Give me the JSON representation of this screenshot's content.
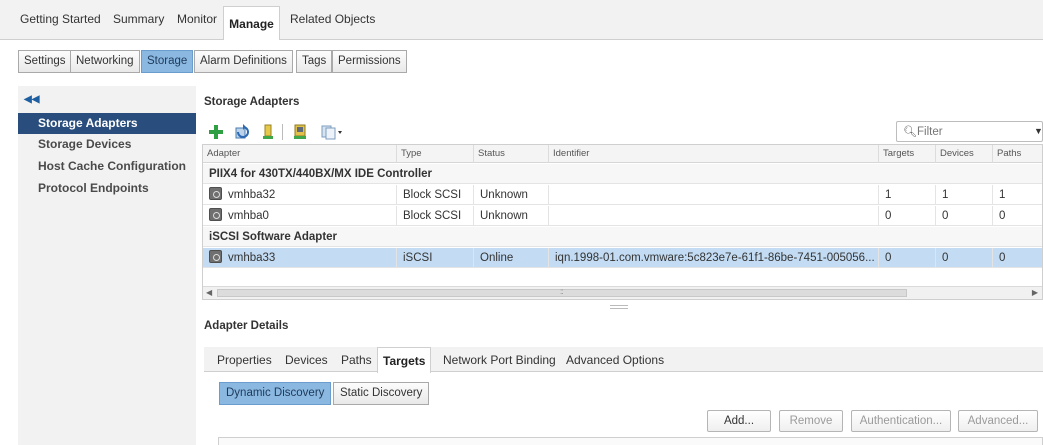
{
  "top_tabs": [
    "Getting Started",
    "Summary",
    "Monitor",
    "Manage",
    "Related Objects"
  ],
  "sub_tabs": [
    "Settings",
    "Networking",
    "Storage",
    "Alarm Definitions",
    "Tags",
    "Permissions"
  ],
  "leftnav": {
    "items": [
      "Storage Adapters",
      "Storage Devices",
      "Host Cache Configuration",
      "Protocol Endpoints"
    ]
  },
  "main": {
    "title": "Storage Adapters",
    "filter_placeholder": "Filter"
  },
  "grid": {
    "columns": [
      "Adapter",
      "Type",
      "Status",
      "Identifier",
      "Targets",
      "Devices",
      "Paths"
    ],
    "group1": "PIIX4 for 430TX/440BX/MX IDE Controller",
    "group2": "iSCSI Software Adapter",
    "rows": [
      {
        "adapter": "vmhba32",
        "type": "Block SCSI",
        "status": "Unknown",
        "identifier": "",
        "targets": "1",
        "devices": "1",
        "paths": "1"
      },
      {
        "adapter": "vmhba0",
        "type": "Block SCSI",
        "status": "Unknown",
        "identifier": "",
        "targets": "0",
        "devices": "0",
        "paths": "0"
      },
      {
        "adapter": "vmhba33",
        "type": "iSCSI",
        "status": "Online",
        "identifier": "iqn.1998-01.com.vmware:5c823e7e-61f1-86be-7451-005056...",
        "targets": "0",
        "devices": "0",
        "paths": "0"
      }
    ]
  },
  "details": {
    "title": "Adapter Details",
    "tabs": [
      "Properties",
      "Devices",
      "Paths",
      "Targets",
      "Network Port Binding",
      "Advanced Options"
    ],
    "discovery_tabs": [
      "Dynamic Discovery",
      "Static Discovery"
    ],
    "buttons": [
      "Add...",
      "Remove",
      "Authentication...",
      "Advanced..."
    ]
  },
  "colors": {
    "accent": "#294e7d",
    "selected_row": "#c3dcf3",
    "active_button": "#8ab8e0"
  }
}
